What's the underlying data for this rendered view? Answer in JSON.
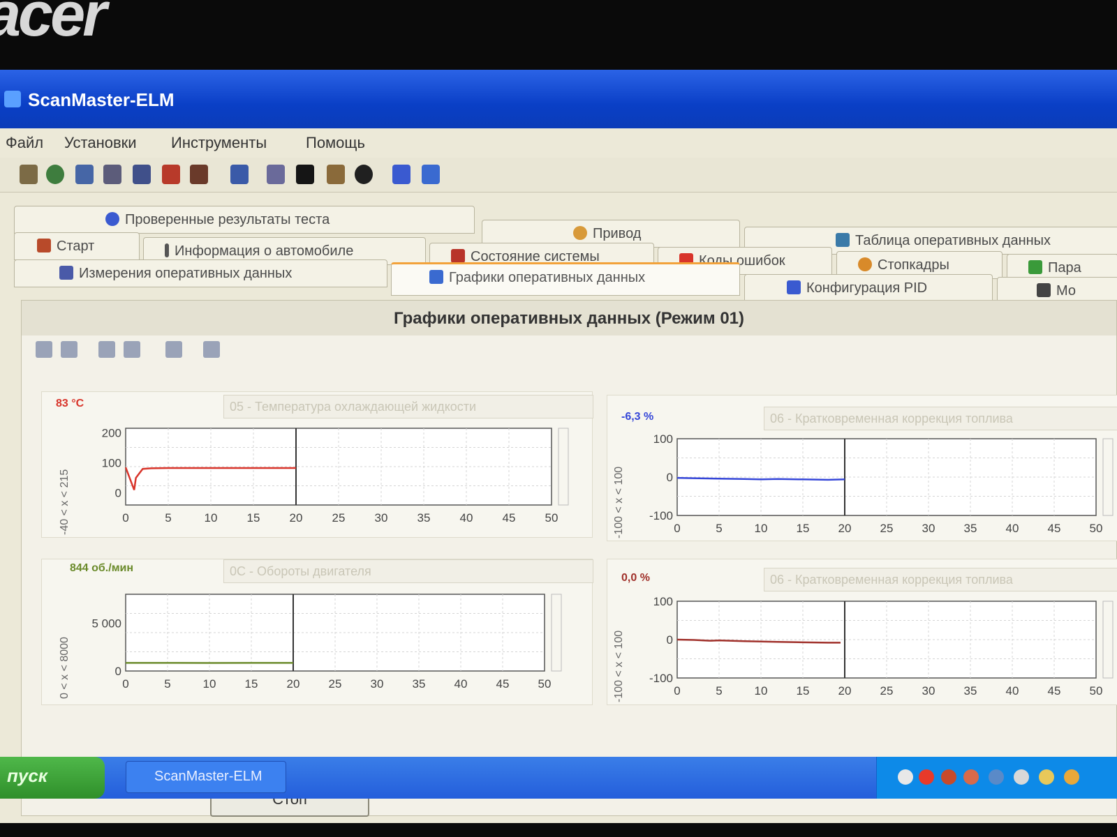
{
  "window": {
    "title": "ScanMaster-ELM"
  },
  "menu": [
    "Файл",
    "Установки",
    "Инструменты",
    "Помощь"
  ],
  "tabs": {
    "row1": [
      "Проверенные результаты теста",
      "Привод",
      "Таблица оперативных данных"
    ],
    "row2": [
      "Старт",
      "Информация о автомобиле",
      "Состояние системы",
      "Коды ошибок",
      "Стопкадры",
      "Пара"
    ],
    "row3": [
      "Измерения оперативных данных",
      "Графики оперативных данных",
      "Конфигурация PID",
      "Мо"
    ]
  },
  "panel": {
    "title": "Графики оперативных данных (Режим 01)"
  },
  "charts": [
    {
      "value": "83 °C",
      "value_color": "#d8342a",
      "pid": "05 - Температура охлаждающей жидкости",
      "y_range_text": "-40 <  x  <  215"
    },
    {
      "value": "-6,3 %",
      "value_color": "#3546d8",
      "pid": "06 - Кратковременная коррекция топлива",
      "y_range_text": "-100 <  x  <  100"
    },
    {
      "value": "844 об./мин",
      "value_color": "#6a8a2a",
      "pid": "0C - Обороты двигателя",
      "y_range_text": "0  <  x  <  8000"
    },
    {
      "value": "0,0 %",
      "value_color": "#a0302a",
      "pid": "06 - Кратковременная коррекция топлива",
      "y_range_text": "-100 <  x  <  100"
    }
  ],
  "chart_data": [
    {
      "type": "line",
      "series": [
        {
          "color": "#d8342a",
          "x": [
            0,
            1,
            1.2,
            2,
            3,
            5,
            10,
            15,
            20
          ],
          "y": [
            85,
            10,
            50,
            80,
            82,
            83,
            83,
            83,
            83
          ]
        }
      ],
      "ylim": [
        -40,
        215
      ],
      "xlim": [
        0,
        50
      ],
      "yticks": [
        "200",
        "100",
        "0"
      ],
      "xticks": [
        "0",
        "5",
        "10",
        "15",
        "20",
        "25",
        "30",
        "35",
        "40",
        "45",
        "50"
      ],
      "cursor_x": 20
    },
    {
      "type": "line",
      "series": [
        {
          "color": "#3546d8",
          "x": [
            0,
            2,
            5,
            8,
            10,
            12,
            15,
            18,
            20
          ],
          "y": [
            -2,
            -3,
            -4,
            -5,
            -6,
            -5,
            -6,
            -7,
            -6
          ]
        }
      ],
      "ylim": [
        -100,
        100
      ],
      "xlim": [
        0,
        50
      ],
      "yticks": [
        "100",
        "0",
        "-100"
      ],
      "xticks": [
        "0",
        "5",
        "10",
        "15",
        "20",
        "25",
        "30",
        "35",
        "40",
        "45",
        "50"
      ],
      "cursor_x": 20
    },
    {
      "type": "line",
      "series": [
        {
          "color": "#6a8a2a",
          "x": [
            0,
            5,
            10,
            15,
            20
          ],
          "y": [
            850,
            845,
            840,
            845,
            844
          ]
        }
      ],
      "ylim": [
        0,
        8000
      ],
      "xlim": [
        0,
        50
      ],
      "yticks": [
        "5 000",
        "0"
      ],
      "xticks": [
        "0",
        "5",
        "10",
        "15",
        "20",
        "25",
        "30",
        "35",
        "40",
        "45",
        "50"
      ],
      "cursor_x": 20
    },
    {
      "type": "line",
      "series": [
        {
          "color": "#a0302a",
          "x": [
            0,
            2,
            4,
            5,
            8,
            10,
            12,
            15,
            18,
            19.5
          ],
          "y": [
            0,
            -1,
            -3,
            -2,
            -4,
            -5,
            -6,
            -7,
            -8,
            -8
          ]
        }
      ],
      "ylim": [
        -100,
        100
      ],
      "xlim": [
        0,
        50
      ],
      "yticks": [
        "100",
        "0",
        "-100"
      ],
      "xticks": [
        "0",
        "5",
        "10",
        "15",
        "20",
        "25",
        "30",
        "35",
        "40",
        "45",
        "50"
      ],
      "cursor_x": 20
    }
  ],
  "stop_button": "Стоп",
  "taskbar": {
    "start": "пуск",
    "task": "ScanMaster-ELM"
  },
  "colors": {
    "titlebar": "#0a3fc6",
    "taskbar": "#245edb",
    "tab_accent": "#f2a23a"
  }
}
